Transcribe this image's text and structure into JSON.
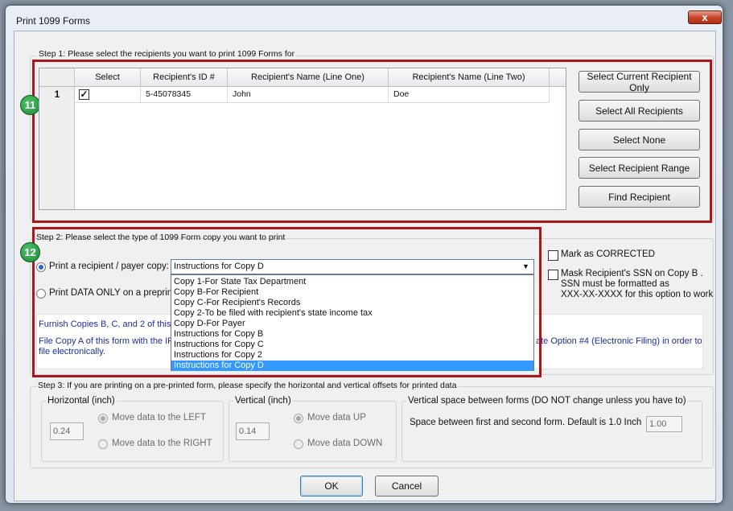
{
  "window": {
    "title": "Print 1099 Forms",
    "close_glyph": "x"
  },
  "step1": {
    "label": "Step 1: Please select the recipients you want to print 1099 Forms for",
    "badge": "11",
    "columns": [
      "Select",
      "Recipient's ID #",
      "Recipient's Name (Line One)",
      "Recipient's Name (Line Two)"
    ],
    "rows": [
      {
        "num": "1",
        "checked": "✓",
        "id": "5-45078345",
        "name1": "John",
        "name2": "Doe"
      }
    ],
    "buttons": {
      "current": "Select Current Recipient Only",
      "all": "Select All Recipients",
      "none": "Select None",
      "range": "Select Recipient Range",
      "find": "Find Recipient"
    }
  },
  "step2": {
    "label": "Step 2: Please select the type of 1099 Form copy you want to print",
    "badge": "12",
    "radio_copy_label": "Print a recipient / payer copy:",
    "radio_data_label": "Print DATA ONLY on a preprinte",
    "combo_value": "Instructions for Copy D",
    "combo_arrow": "▼",
    "dropdown_items": [
      "Copy 1-For State Tax Department",
      "Copy B-For Recipient",
      "Copy C-For Recipient's Records",
      "Copy 2-To be filed with recipient's state income tax",
      "Copy D-For Payer",
      "Instructions for Copy B",
      "Instructions for Copy C",
      "Instructions for Copy 2",
      "Instructions for Copy D"
    ],
    "mark_corrected": "Mark as CORRECTED",
    "mask_ssn_line1": "Mask Recipient's SSN on Copy B .",
    "mask_ssn_line2": "SSN must be formatted as",
    "mask_ssn_line3": "XXX-XX-XXXX for this option to work",
    "info_line1": "Furnish Copies B, C, and 2 of this fo",
    "info_line2a": "File Copy A of this form with the IRS",
    "info_line2b": "ate Option #4 (Electronic Filing) in order to",
    "info_line3": "file electronically."
  },
  "step3": {
    "label": "Step 3: If you are printing on a pre-printed form, please specify the horizontal and vertical offsets for printed data",
    "horizontal": {
      "title": "Horizontal (inch)",
      "value": "0.24",
      "left": "Move data to the LEFT",
      "right": "Move data to the RIGHT"
    },
    "vertical": {
      "title": "Vertical (inch)",
      "value": "0.14",
      "up": "Move data UP",
      "down": "Move data DOWN"
    },
    "spacing": {
      "title": "Vertical space between forms (DO NOT change unless you have to)",
      "label": "Space between first and second form. Default is 1.0 Inch",
      "value": "1.00"
    }
  },
  "footer": {
    "ok": "OK",
    "cancel": "Cancel"
  },
  "colors": {
    "annotation_red": "#a8161e",
    "badge_green": "#1e8a36",
    "selection_blue": "#3399ff",
    "info_text": "#1b2fa0"
  }
}
